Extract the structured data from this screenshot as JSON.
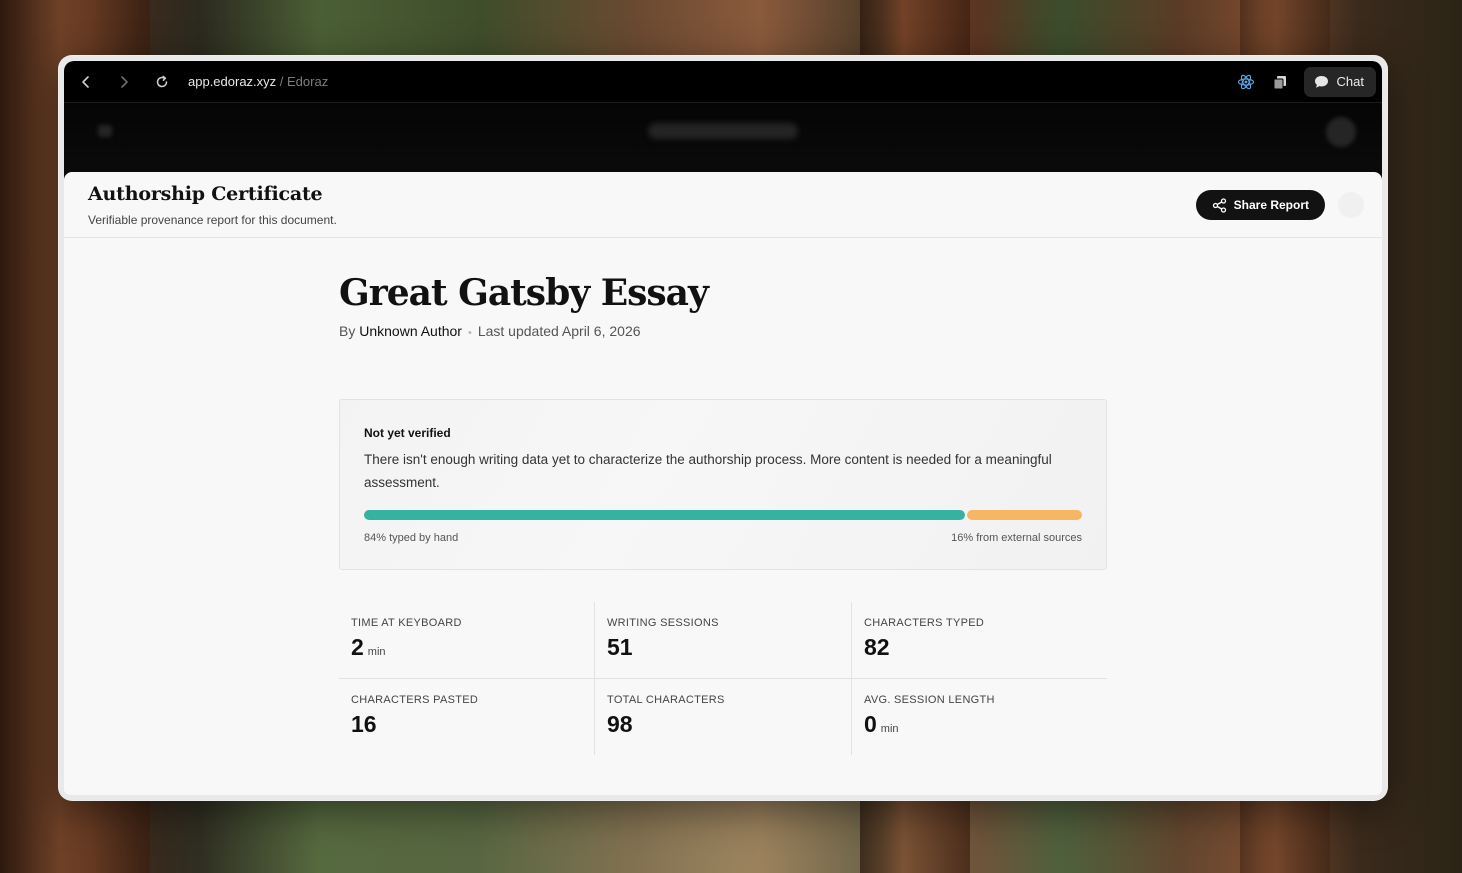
{
  "browser": {
    "url_host": "app.edoraz.xyz",
    "url_separator": " / ",
    "site_name": "Edoraz",
    "chat_label": "Chat"
  },
  "sheet": {
    "title": "Authorship Certificate",
    "subtitle": "Verifiable provenance report for this document.",
    "share_label": "Share Report"
  },
  "document": {
    "title": "Great Gatsby Essay",
    "by_prefix": "By ",
    "author": "Unknown Author",
    "separator": "•",
    "updated": "Last updated April 6, 2026"
  },
  "verification": {
    "status": "Not yet verified",
    "message": "There isn't enough writing data yet to characterize the authorship process. More content is needed for a meaningful assessment.",
    "typed_percent": 84,
    "external_percent": 16,
    "typed_label": "84% typed by hand",
    "external_label": "16% from external sources",
    "colors": {
      "typed": "#35b3a0",
      "external": "#f5b763"
    }
  },
  "stats": [
    {
      "label": "TIME AT KEYBOARD",
      "value": "2",
      "unit": "min"
    },
    {
      "label": "WRITING SESSIONS",
      "value": "51",
      "unit": ""
    },
    {
      "label": "CHARACTERS TYPED",
      "value": "82",
      "unit": ""
    },
    {
      "label": "CHARACTERS PASTED",
      "value": "16",
      "unit": ""
    },
    {
      "label": "TOTAL CHARACTERS",
      "value": "98",
      "unit": ""
    },
    {
      "label": "AVG. SESSION LENGTH",
      "value": "0",
      "unit": "min"
    }
  ],
  "icons": {
    "back": "chevron-left-icon",
    "forward": "chevron-right-icon",
    "reload": "reload-icon",
    "extension_1": "react-atom-icon",
    "extension_2": "copy-pages-icon",
    "chat": "chat-bubble-icon",
    "share": "share-nodes-icon"
  }
}
